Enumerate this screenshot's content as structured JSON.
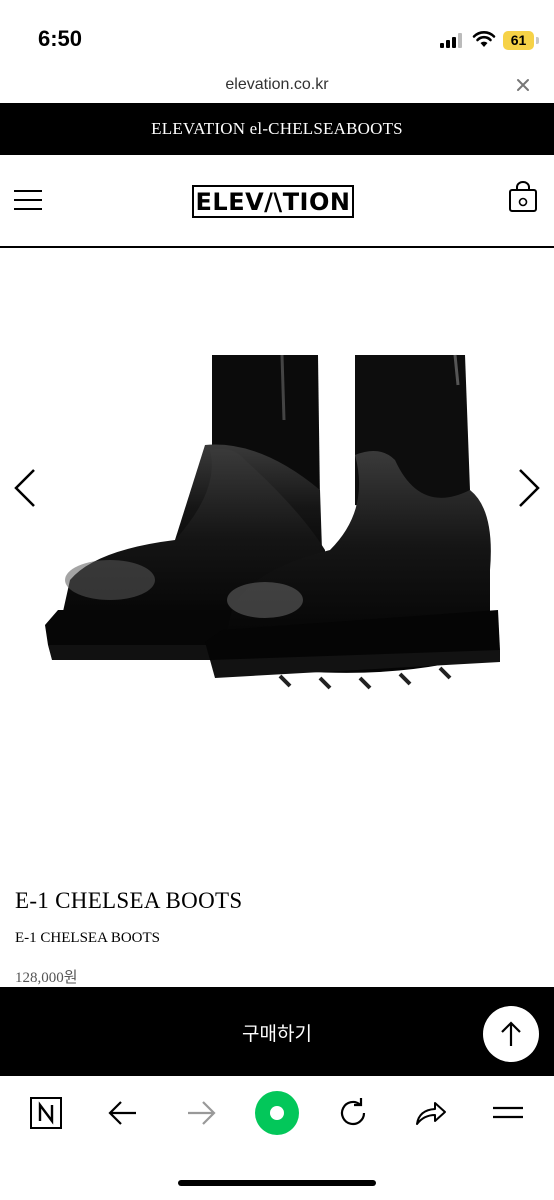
{
  "status_bar": {
    "time": "6:50",
    "battery": "61",
    "battery_color": "#f6d247"
  },
  "browser": {
    "url": "elevation.co.kr",
    "close_icon": "close-icon"
  },
  "announcement": {
    "text": "ELEVATION el-CHELSEABOOTS"
  },
  "header": {
    "logo": "ELEV/\\TION",
    "menu_icon": "hamburger-menu-icon",
    "cart_icon": "shopping-bag-icon"
  },
  "product": {
    "title": "E-1 CHELSEA BOOTS",
    "subtitle": "E-1 CHELSEA BOOTS",
    "price": "128,000원",
    "image": "black-chelsea-boots-photo"
  },
  "buy": {
    "label": "구매하기"
  },
  "toolbar": {
    "items": [
      "naver-home-icon",
      "back-arrow-icon",
      "forward-arrow-icon",
      "green-dot-icon",
      "reload-icon",
      "share-icon",
      "menu-lines-icon"
    ],
    "accent_color": "#03c75a"
  }
}
